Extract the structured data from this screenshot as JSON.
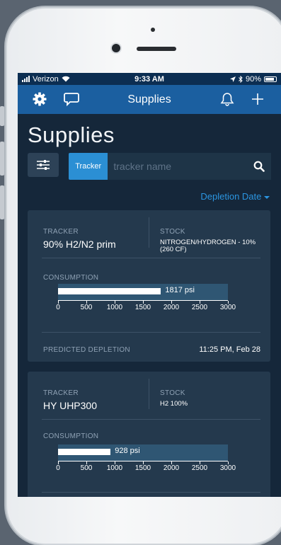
{
  "status_bar": {
    "carrier": "Verizon",
    "time": "9:33 AM",
    "battery": "90%"
  },
  "nav": {
    "title": "Supplies"
  },
  "page": {
    "title": "Supplies"
  },
  "search": {
    "chip_label": "Tracker",
    "placeholder": "tracker name",
    "value": ""
  },
  "sort": {
    "label": "Depletion Date"
  },
  "axis": {
    "min": 0,
    "max": 3000,
    "ticks": [
      "0",
      "500",
      "1000",
      "1500",
      "2000",
      "2500",
      "3000"
    ]
  },
  "cards": [
    {
      "tracker_label": "TRACKER",
      "tracker": "90% H2/N2 prim",
      "stock_label": "STOCK",
      "stock": "NITROGEN/HYDROGEN - 10% (260 CF)",
      "consumption_label": "CONSUMPTION",
      "consumption_value": 1817,
      "consumption_text": "1817 psi",
      "predicted_label": "PREDICTED DEPLETION",
      "predicted": "11:25 PM, Feb 28"
    },
    {
      "tracker_label": "TRACKER",
      "tracker": "HY UHP300",
      "stock_label": "STOCK",
      "stock": "H2 100%",
      "consumption_label": "CONSUMPTION",
      "consumption_value": 928,
      "consumption_text": "928 psi"
    }
  ],
  "colors": {
    "accent": "#2b8fd4",
    "navbar": "#1b5fa0",
    "background": "#15273a",
    "card": "#24394d"
  }
}
